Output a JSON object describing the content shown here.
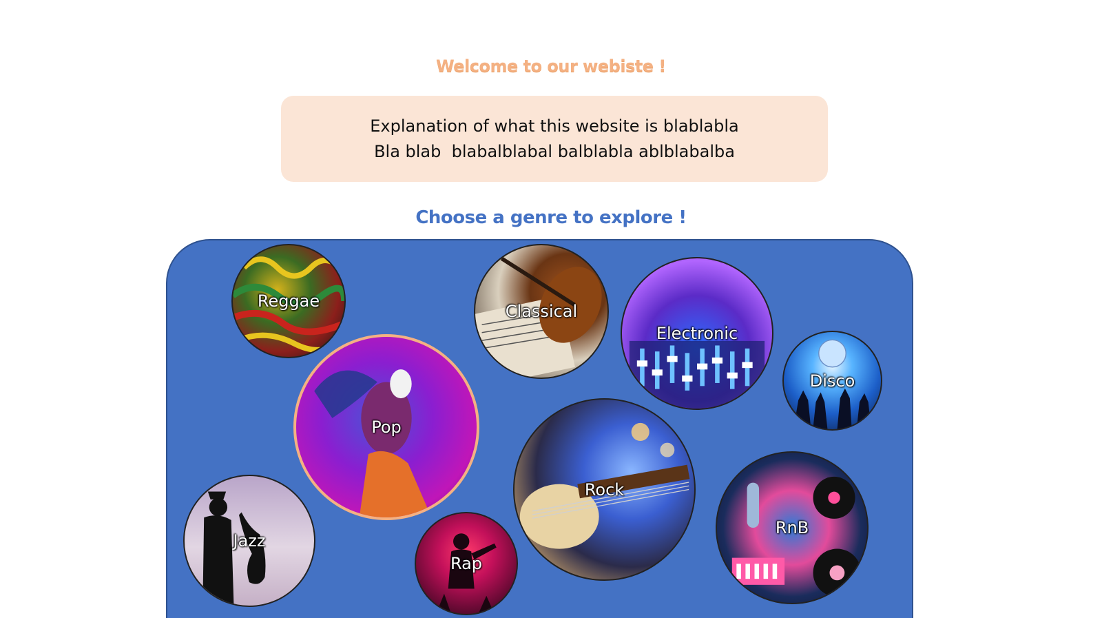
{
  "header": {
    "welcome_text": "Welcome to our webiste !"
  },
  "explanation": {
    "line1": "Explanation of what this website is blablabla",
    "line2": "Bla blab  blabalblabal balblabla ablblabalba"
  },
  "genre_section": {
    "title": "Choose a genre to explore !",
    "genres": [
      {
        "label": "Reggae"
      },
      {
        "label": "Classical"
      },
      {
        "label": "Electronic"
      },
      {
        "label": "Disco"
      },
      {
        "label": "Pop"
      },
      {
        "label": "Rock"
      },
      {
        "label": "RnB"
      },
      {
        "label": "Jazz"
      },
      {
        "label": "Rap"
      }
    ]
  },
  "colors": {
    "welcome_orange": "#f4b183",
    "explanation_bg": "#fbe5d6",
    "accent_blue": "#4472c4",
    "pop_border": "#f4b183"
  }
}
